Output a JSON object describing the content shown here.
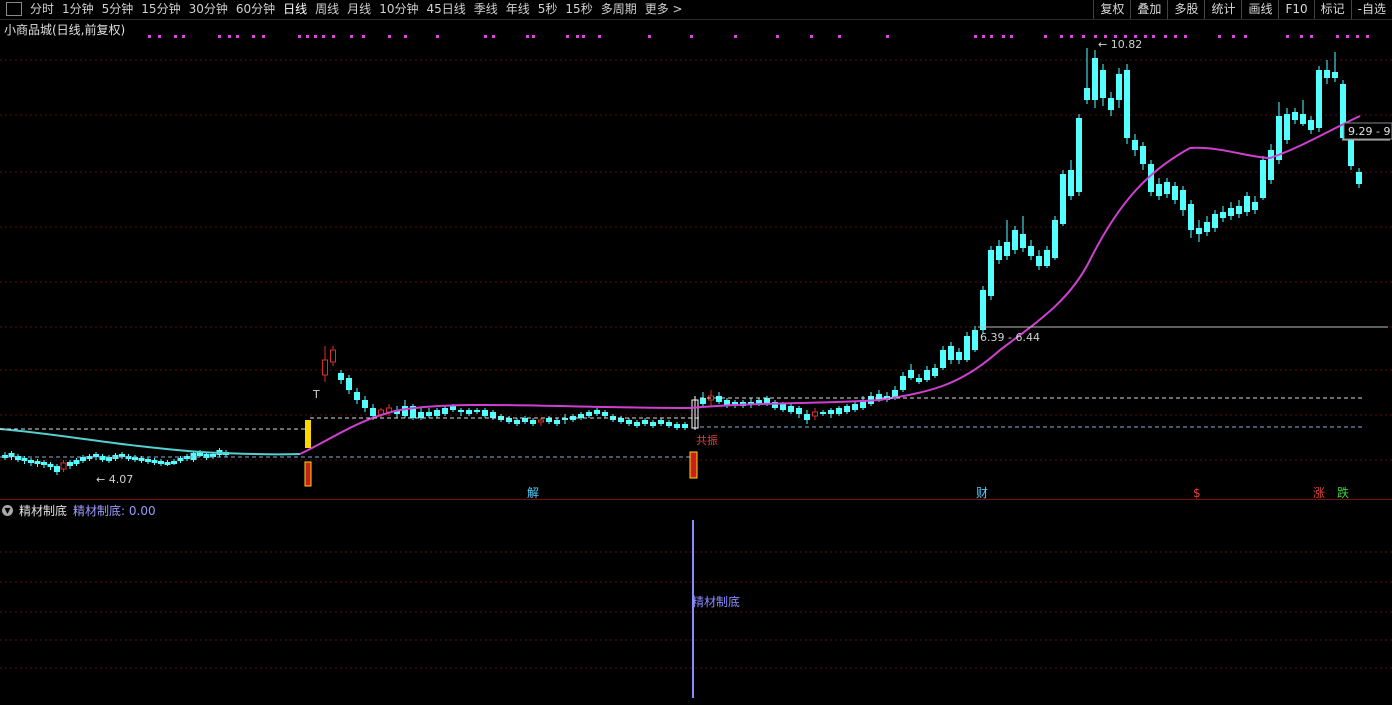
{
  "toolbar": {
    "periods": [
      "分时",
      "1分钟",
      "5分钟",
      "15分钟",
      "30分钟",
      "60分钟",
      "日线",
      "周线",
      "月线",
      "10分钟",
      "45日线",
      "季线",
      "年线",
      "5秒",
      "15秒",
      "多周期",
      "更多 >"
    ],
    "active_period": "日线",
    "right_tools": [
      "复权",
      "叠加",
      "多股",
      "统计",
      "画线",
      "F10",
      "标记",
      "-自选"
    ]
  },
  "chart": {
    "title": "小商品城(日线,前复权)",
    "low_label": "4.07",
    "high_label": "10.82",
    "range_label": "6.39 - 6.44",
    "last_label": "9.29 - 9",
    "signal_label": "共振",
    "t_marker": "T",
    "event_markers": {
      "jie": "解",
      "cai": "财",
      "dollar": "$",
      "zhang": "涨",
      "die": "跌"
    },
    "colors": {
      "up": "#d8302a",
      "down": "#54ffff",
      "ma": "#d040d0",
      "ma_flat": "#54d0d0",
      "grid": "#5a1010",
      "signal": "#ffd700"
    }
  },
  "indicator": {
    "name": "精材制底",
    "value_label": "精材制底: 0.00",
    "bar_label": "精材制底"
  }
}
